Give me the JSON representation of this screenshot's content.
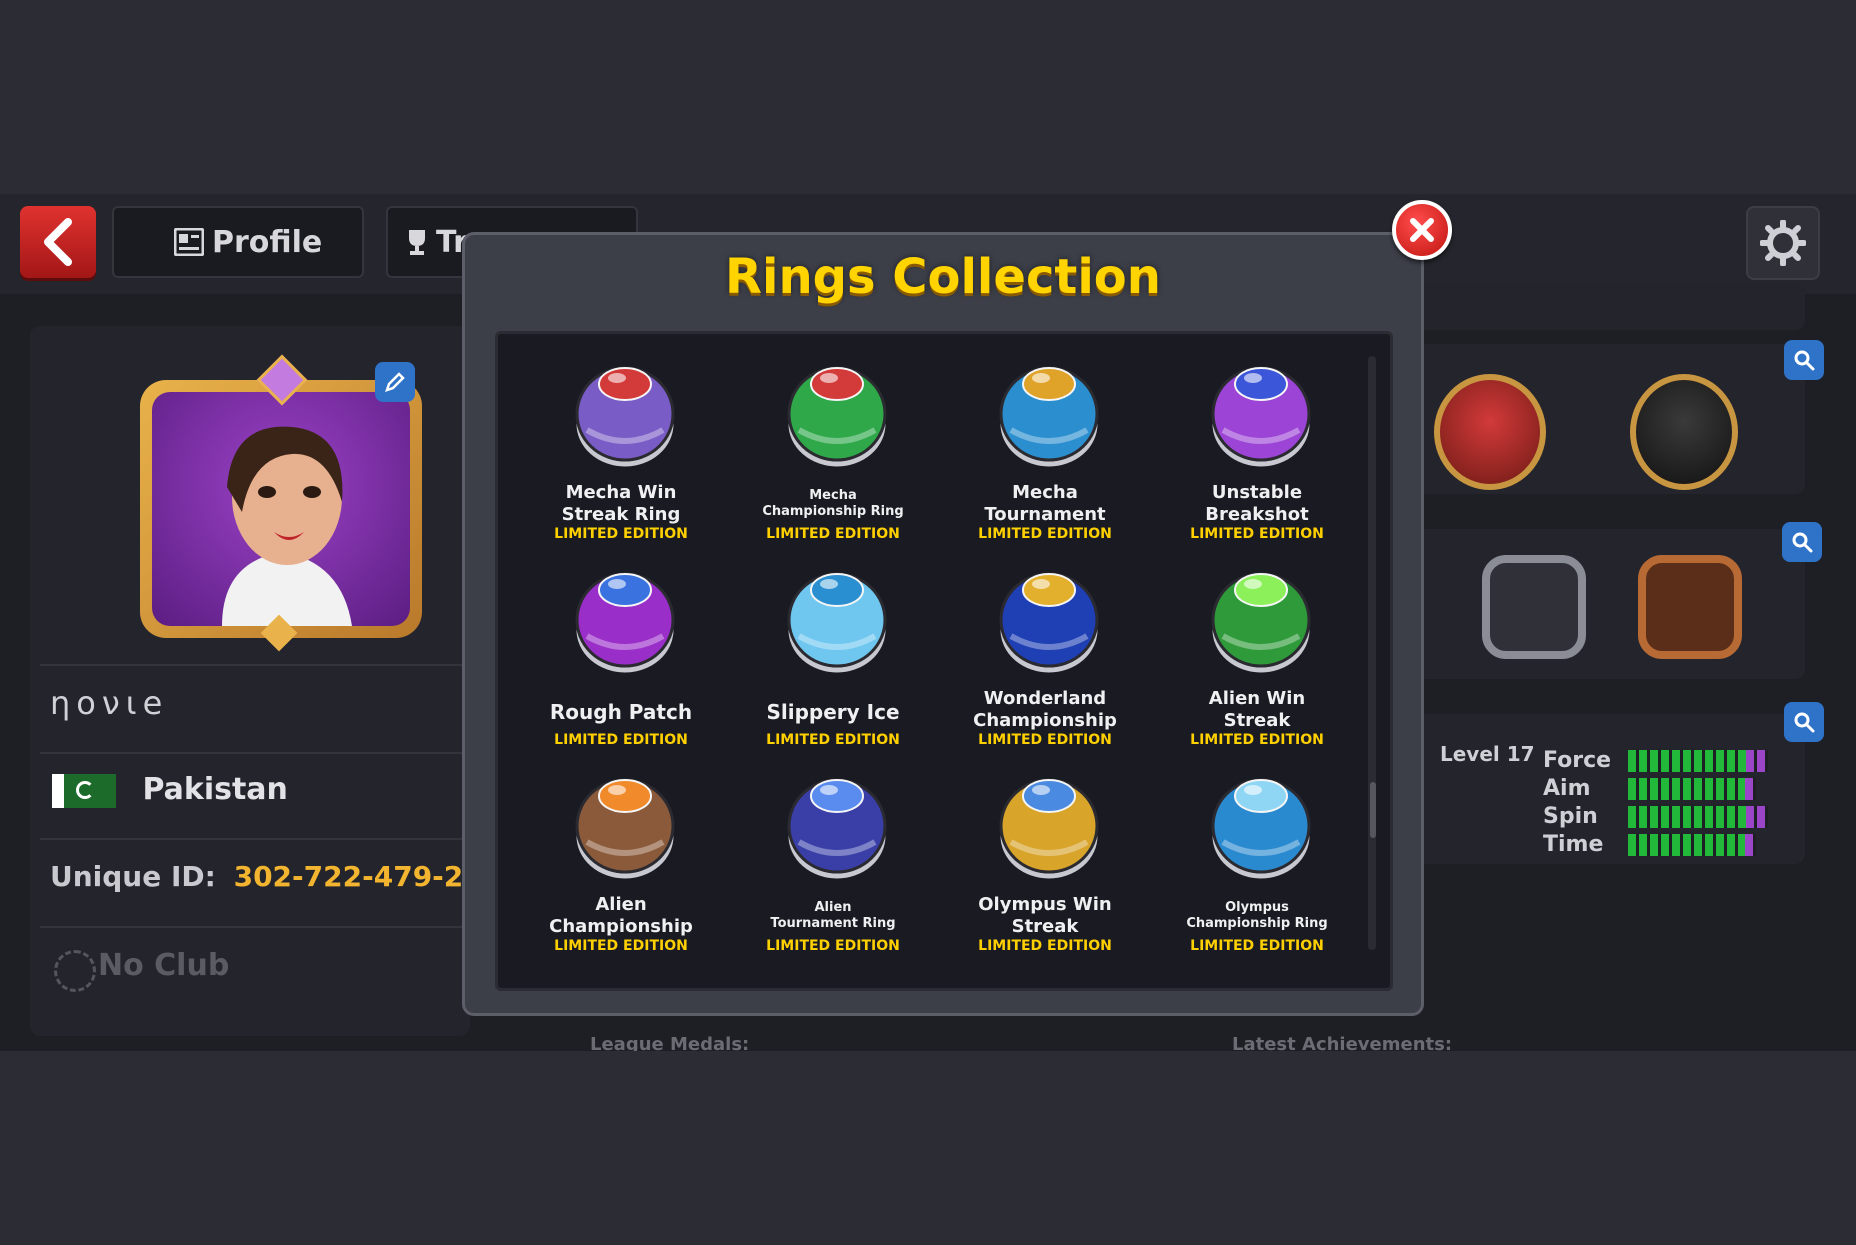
{
  "header": {
    "profile_tab": "Profile",
    "trophies_tab": "Tr"
  },
  "profile": {
    "username": "ηονιe",
    "country": "Pakistan",
    "unique_id_label": "Unique ID:",
    "unique_id_value": "302-722-479-2",
    "club": "No Club"
  },
  "background_stats": {
    "level": "Level 17",
    "stats": [
      {
        "label": "Force",
        "level": 12,
        "max": 12
      },
      {
        "label": "Aim",
        "level": 11,
        "max": 12
      },
      {
        "label": "Spin",
        "level": 12,
        "max": 12
      },
      {
        "label": "Time",
        "level": 11,
        "max": 12
      }
    ],
    "league_medals_label": "League Medals:",
    "latest_achievements_label": "Latest Achievements:"
  },
  "modal": {
    "title": "Rings Collection",
    "rings": [
      {
        "name_line1": "Mecha Win",
        "name_line2": "Streak Ring",
        "edition": "LIMITED EDITION",
        "color": "#7a5cc7",
        "accent": "#d33a3a"
      },
      {
        "name_line1": "Mecha",
        "name_line2": "Championship Ring",
        "edition": "LIMITED EDITION",
        "color": "#2fa84a",
        "accent": "#d33a3a"
      },
      {
        "name_line1": "Mecha",
        "name_line2": "Tournament",
        "edition": "LIMITED EDITION",
        "color": "#2b8fcf",
        "accent": "#e0a32a"
      },
      {
        "name_line1": "Unstable",
        "name_line2": "Breakshot",
        "edition": "LIMITED EDITION",
        "color": "#9b44d6",
        "accent": "#3b56d8"
      },
      {
        "name_line1": "Rough Patch",
        "name_line2": "",
        "edition": "LIMITED EDITION",
        "color": "#9a2ec9",
        "accent": "#3a72e0"
      },
      {
        "name_line1": "Slippery Ice",
        "name_line2": "",
        "edition": "LIMITED EDITION",
        "color": "#6fc7f0",
        "accent": "#2a8fd0"
      },
      {
        "name_line1": "Wonderland",
        "name_line2": "Championship",
        "edition": "LIMITED EDITION",
        "color": "#1f3fb5",
        "accent": "#e3b02d"
      },
      {
        "name_line1": "Alien Win",
        "name_line2": "Streak",
        "edition": "LIMITED EDITION",
        "color": "#2f9a3a",
        "accent": "#8bf05a"
      },
      {
        "name_line1": "Alien",
        "name_line2": "Championship",
        "edition": "LIMITED EDITION",
        "color": "#8a5a3a",
        "accent": "#f08a2a"
      },
      {
        "name_line1": "Alien",
        "name_line2": "Tournament Ring",
        "edition": "LIMITED EDITION",
        "color": "#3a3fa8",
        "accent": "#5a8cf0"
      },
      {
        "name_line1": "Olympus Win",
        "name_line2": "Streak",
        "edition": "LIMITED EDITION",
        "color": "#d8a42a",
        "accent": "#4a8ae0"
      },
      {
        "name_line1": "Olympus",
        "name_line2": "Championship Ring",
        "edition": "LIMITED EDITION",
        "color": "#2a8ad0",
        "accent": "#8fd6f5"
      }
    ]
  },
  "colors": {
    "title_yellow": "#ffd400",
    "edition_yellow": "#ffd000",
    "id_orange": "#f3b52f",
    "close_red": "#d41a14"
  },
  "icons": {
    "back": "back-arrow-icon",
    "profile": "profile-card-icon",
    "trophy": "trophy-icon",
    "settings": "gear-icon",
    "close": "close-icon",
    "search": "search-icon",
    "edit": "pencil-icon"
  }
}
